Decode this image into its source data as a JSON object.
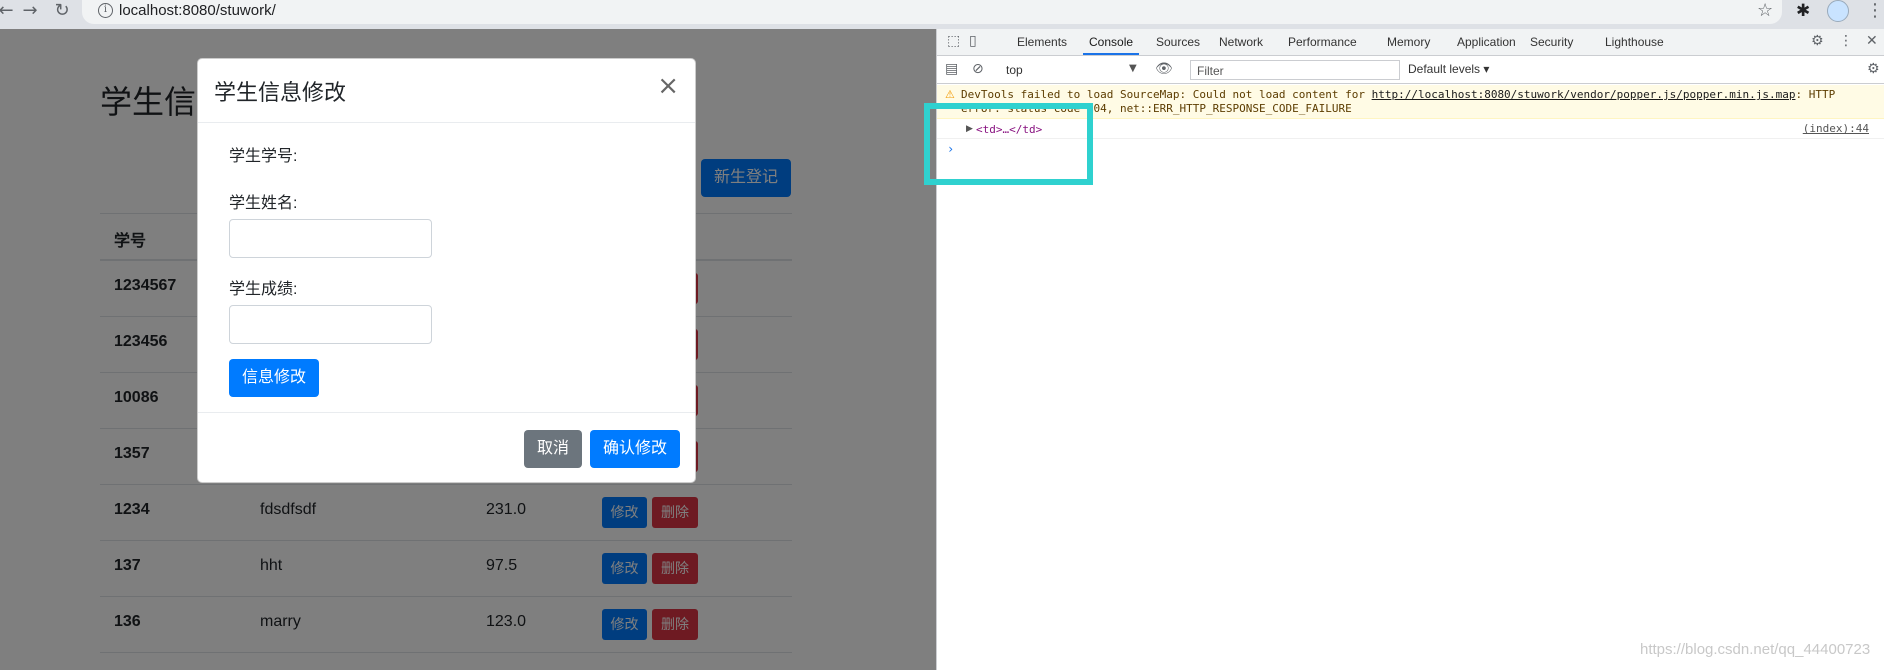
{
  "browser": {
    "back_icon": "arrow-left",
    "forward_icon": "arrow-right",
    "reload_icon": "reload",
    "url": "localhost:8080/stuwork/"
  },
  "page": {
    "title": "学生信息",
    "new_button": "新生登记",
    "table": {
      "header_id": "学号",
      "rows": [
        {
          "id": "1234567",
          "name": "",
          "score": ""
        },
        {
          "id": "123456",
          "name": "",
          "score": ""
        },
        {
          "id": "10086",
          "name": "",
          "score": ""
        },
        {
          "id": "1357",
          "name": "",
          "score": ""
        },
        {
          "id": "1234",
          "name": "fdsdfsdf",
          "score": "231.0"
        },
        {
          "id": "137",
          "name": "hht",
          "score": "97.5"
        },
        {
          "id": "136",
          "name": "marry",
          "score": "123.0"
        }
      ],
      "edit_label": "修改",
      "delete_label": "删除"
    }
  },
  "modal": {
    "title": "学生信息修改",
    "close": "×",
    "label_id": "学生学号:",
    "label_name": "学生姓名:",
    "label_score": "学生成绩:",
    "update_button": "信息修改",
    "cancel_button": "取消",
    "confirm_button": "确认修改"
  },
  "devtools": {
    "tabs": [
      "Elements",
      "Console",
      "Sources",
      "Network",
      "Performance",
      "Memory",
      "Application",
      "Security",
      "Lighthouse"
    ],
    "active_tab": "Console",
    "context": "top",
    "filter_placeholder": "Filter",
    "levels": "Default levels",
    "warning_prefix": "DevTools failed to load SourceMap: Could not load content for ",
    "warning_link": "http://localhost:8080/stuwork/vendor/popper.js/popper.min.js.map",
    "warning_suffix": ": HTTP",
    "warning_line2": "error: status code 404, net::ERR_HTTP_RESPONSE_CODE_FAILURE",
    "log_entry": "<td>…</td>",
    "log_source": "(index):44",
    "prompt": "›"
  },
  "watermark": "https://blog.csdn.net/qq_44400723",
  "colors": {
    "primary": "#007bff",
    "danger": "#dc3545",
    "secondary": "#6c757d",
    "highlight": "#2fd1cf"
  }
}
